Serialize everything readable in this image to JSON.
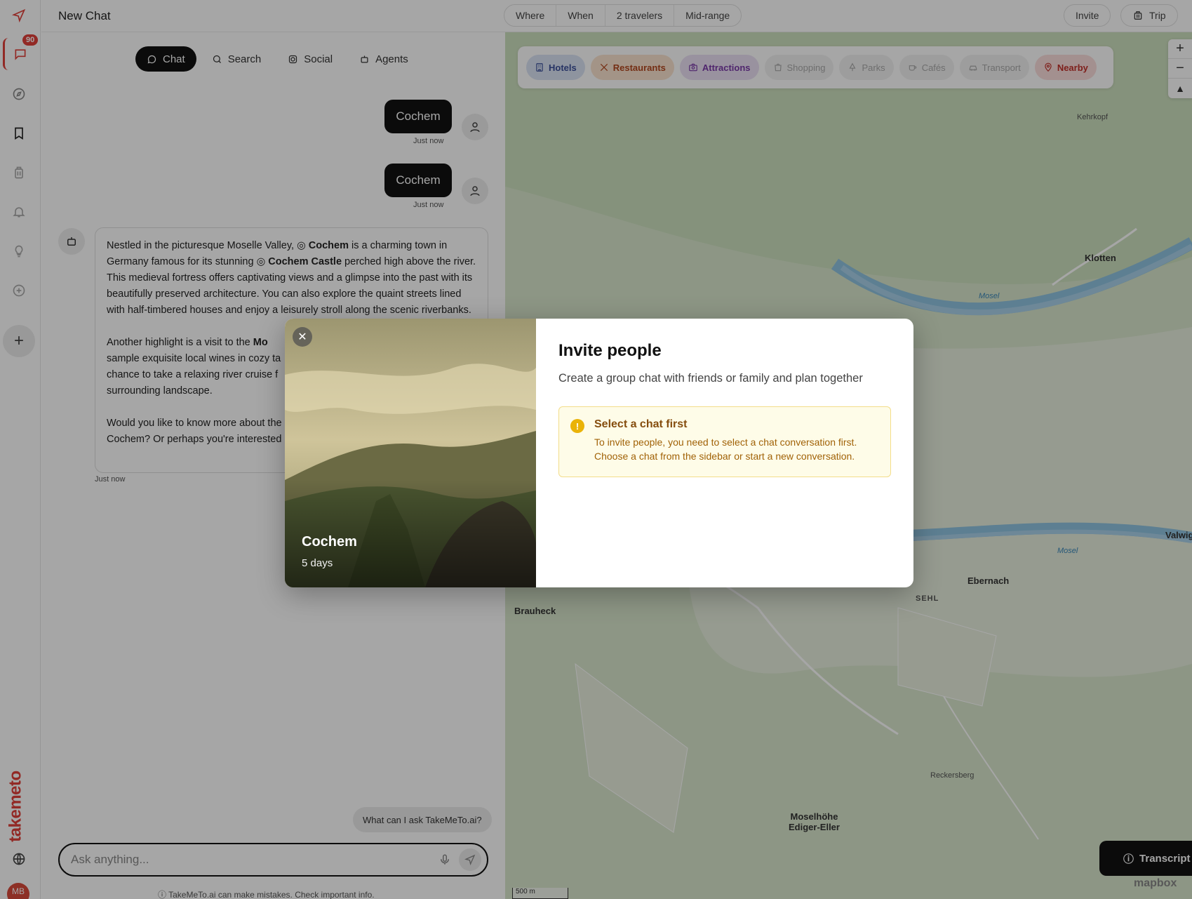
{
  "header": {
    "title": "New Chat",
    "filters": [
      "Where",
      "When",
      "2 travelers",
      "Mid-range"
    ],
    "invite_label": "Invite",
    "trip_label": "Trip"
  },
  "rail": {
    "badge_count": "90",
    "brand": "takemeto",
    "avatar_initials": "MB"
  },
  "chat": {
    "tabs": [
      {
        "label": "Chat",
        "icon": "chat-bubble-icon",
        "active": true
      },
      {
        "label": "Search",
        "icon": "search-icon",
        "active": false
      },
      {
        "label": "Social",
        "icon": "instagram-icon",
        "active": false
      },
      {
        "label": "Agents",
        "icon": "robot-icon",
        "active": false
      }
    ],
    "messages": [
      {
        "role": "user",
        "text": "Cochem",
        "time": "Just now"
      },
      {
        "role": "user",
        "text": "Cochem",
        "time": "Just now"
      }
    ],
    "bot": {
      "p1_a": "Nestled in the picturesque Moselle Valley, ",
      "p1_place1": "Cochem",
      "p1_b": " is a charming town in Germany famous for its stunning ",
      "p1_place2": "Cochem Castle",
      "p1_c": " perched high above the river. This medieval fortress offers captivating views and a glimpse into the past with its beautifully preserved architecture. You can also explore the quaint streets lined with half-timbered houses and enjoy a leisurely stroll along the scenic riverbanks.",
      "p2_a": "Another highlight is a visit to the ",
      "p2_bold": "Mo",
      "p2_b": "sample exquisite local wines in cozy ta",
      "p2_c": "chance to take a relaxing river cruise f",
      "p2_d": "surrounding landscape.",
      "p3_a": "Would you like to know more about the",
      "p3_b": "Cochem? Or perhaps you're interested",
      "time": "Just now"
    },
    "suggestion": "What can I ask TakeMeTo.ai?",
    "composer_placeholder": "Ask anything...",
    "disclaimer": "TakeMeTo.ai can make mistakes. Check important info."
  },
  "map": {
    "filters": [
      {
        "label": "Hotels",
        "bg": "#dbe4f5",
        "color": "#3b4f9a"
      },
      {
        "label": "Restaurants",
        "bg": "#fbe4cf",
        "color": "#b2481f"
      },
      {
        "label": "Attractions",
        "bg": "#ece0f5",
        "color": "#7a3aa8"
      },
      {
        "label": "Shopping",
        "bg": "#f1f1f1",
        "color": "#aaaaaa"
      },
      {
        "label": "Parks",
        "bg": "#f1f1f1",
        "color": "#aaaaaa"
      },
      {
        "label": "Cafés",
        "bg": "#f1f1f1",
        "color": "#aaaaaa"
      },
      {
        "label": "Transport",
        "bg": "#f1f1f1",
        "color": "#aaaaaa"
      },
      {
        "label": "Nearby",
        "bg": "#fbdedc",
        "color": "#c2312a"
      }
    ],
    "places": {
      "klotten": "Klotten",
      "kehrkopf": "Kehrkopf",
      "valwig": "Valwig",
      "ebernach": "Ebernach",
      "sehl": "SEHL",
      "brauheck": "Brauheck",
      "reckersberg": "Reckersberg",
      "moselhoehe_1": "Moselhöhe",
      "moselhoehe_2": "Ediger-Eller",
      "river": "Mosel"
    },
    "scale": "500 m",
    "attribution": "mapbox",
    "transcript_label": "Transcript"
  },
  "modal": {
    "image_title": "Cochem",
    "image_subtitle": "5 days",
    "title": "Invite people",
    "description": "Create a group chat with friends or family and plan together",
    "warning_title": "Select a chat first",
    "warning_text": "To invite people, you need to select a chat conversation first. Choose a chat from the sidebar or start a new conversation."
  }
}
